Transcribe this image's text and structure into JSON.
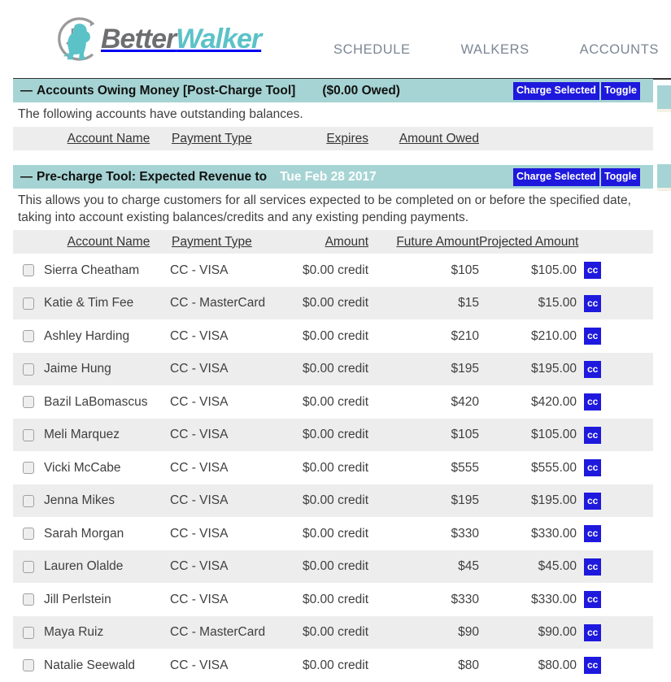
{
  "brand": {
    "name_part1": "Better",
    "name_part2": "Walker",
    "logo_icon": "dog-clock-logo"
  },
  "nav": {
    "items": [
      {
        "label": "SCHEDULE",
        "name": "nav-schedule"
      },
      {
        "label": "WALKERS",
        "name": "nav-walkers"
      },
      {
        "label": "ACCOUNTS",
        "name": "nav-accounts"
      }
    ]
  },
  "colors": {
    "panel_teal": "#a6d4d4",
    "button_blue": "#1e19dd",
    "brand_teal": "#5bc2c8",
    "brand_gray": "#6d6e71",
    "row_stripe": "#ededed"
  },
  "panel_owing": {
    "dash": "—",
    "title": "Accounts Owing Money [Post-Charge Tool]",
    "owed": "($0.00 Owed)",
    "charge_button": "Charge Selected",
    "toggle_button": "Toggle",
    "description": "The following accounts have outstanding balances.",
    "columns": [
      "Account Name",
      "Payment Type",
      "Expires",
      "Amount Owed"
    ],
    "rows": []
  },
  "panel_precharge": {
    "dash": "—",
    "title": "Pre-charge Tool: Expected Revenue to",
    "date": "Tue Feb 28 2017",
    "charge_button": "Charge Selected",
    "toggle_button": "Toggle",
    "description": "This allows you to charge customers for all services expected to be completed on or before the specified date, taking into account existing balances/credits and any existing pending payments.",
    "columns": [
      "Account Name",
      "Payment Type",
      "Amount",
      "Future Amount",
      "Projected Amount"
    ],
    "cc_label": "cc",
    "rows": [
      {
        "name": "Sierra Cheatham",
        "payment": "CC - VISA",
        "amount": "$0.00 credit",
        "future": "$105",
        "projected": "$105.00"
      },
      {
        "name": "Katie & Tim Fee",
        "payment": "CC - MasterCard",
        "amount": "$0.00 credit",
        "future": "$15",
        "projected": "$15.00"
      },
      {
        "name": "Ashley Harding",
        "payment": "CC - VISA",
        "amount": "$0.00 credit",
        "future": "$210",
        "projected": "$210.00"
      },
      {
        "name": "Jaime Hung",
        "payment": "CC - VISA",
        "amount": "$0.00 credit",
        "future": "$195",
        "projected": "$195.00"
      },
      {
        "name": "Bazil LaBomascus",
        "payment": "CC - VISA",
        "amount": "$0.00 credit",
        "future": "$420",
        "projected": "$420.00"
      },
      {
        "name": "Meli Marquez",
        "payment": "CC - VISA",
        "amount": "$0.00 credit",
        "future": "$105",
        "projected": "$105.00"
      },
      {
        "name": "Vicki McCabe",
        "payment": "CC - VISA",
        "amount": "$0.00 credit",
        "future": "$555",
        "projected": "$555.00"
      },
      {
        "name": "Jenna Mikes",
        "payment": "CC - VISA",
        "amount": "$0.00 credit",
        "future": "$195",
        "projected": "$195.00"
      },
      {
        "name": "Sarah Morgan",
        "payment": "CC - VISA",
        "amount": "$0.00 credit",
        "future": "$330",
        "projected": "$330.00"
      },
      {
        "name": "Lauren Olalde",
        "payment": "CC - VISA",
        "amount": "$0.00 credit",
        "future": "$45",
        "projected": "$45.00"
      },
      {
        "name": "Jill Perlstein",
        "payment": "CC - VISA",
        "amount": "$0.00 credit",
        "future": "$330",
        "projected": "$330.00"
      },
      {
        "name": "Maya Ruiz",
        "payment": "CC - MasterCard",
        "amount": "$0.00 credit",
        "future": "$90",
        "projected": "$90.00"
      },
      {
        "name": "Natalie Seewald",
        "payment": "CC - VISA",
        "amount": "$0.00 credit",
        "future": "$80",
        "projected": "$80.00"
      }
    ]
  }
}
